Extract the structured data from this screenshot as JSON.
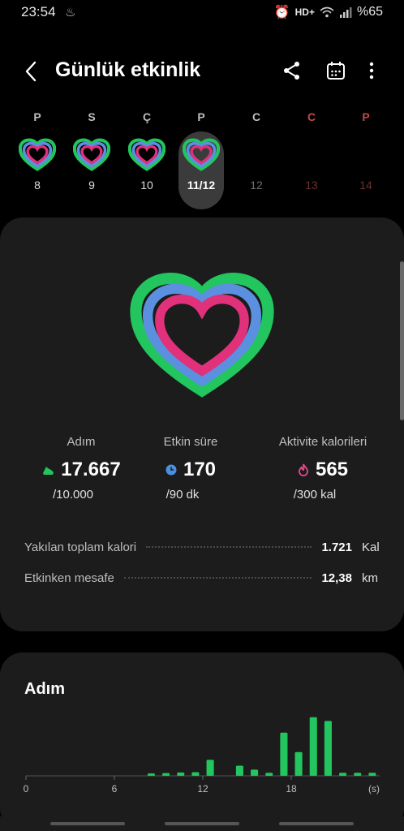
{
  "status": {
    "time": "23:54",
    "network": "HD+",
    "battery": "%65"
  },
  "header": {
    "title": "Günlük etkinlik",
    "share_icon": "share-icon",
    "calendar_icon": "calendar-icon",
    "more_icon": "more-icon"
  },
  "week": [
    {
      "letter": "P",
      "day": "8",
      "has_ring": true
    },
    {
      "letter": "S",
      "day": "9",
      "has_ring": true
    },
    {
      "letter": "Ç",
      "day": "10",
      "has_ring": true
    },
    {
      "letter": "P",
      "day": "11/12",
      "has_ring": true,
      "selected": true
    },
    {
      "letter": "C",
      "day": "12",
      "has_ring": false
    },
    {
      "letter": "C",
      "day": "13",
      "has_ring": false,
      "weekend": true
    },
    {
      "letter": "P",
      "day": "14",
      "has_ring": false,
      "weekend": true
    }
  ],
  "stats": [
    {
      "label": "Adım",
      "value": "17.667",
      "goal": "/10.000",
      "icon": "shoe-icon",
      "color": "#2ecc71"
    },
    {
      "label": "Etkin süre",
      "value": "170",
      "goal": "/90 dk",
      "icon": "clock-icon",
      "color": "#4a90e2"
    },
    {
      "label": "Aktivite kalorileri",
      "value": "565",
      "goal": "/300 kal",
      "icon": "flame-icon",
      "color": "#e84a8a"
    }
  ],
  "summary": [
    {
      "label": "Yakılan toplam kalori",
      "value": "1.721",
      "unit": "Kal"
    },
    {
      "label": "Etkinken mesafe",
      "value": "12,38",
      "unit": "km"
    }
  ],
  "colors": {
    "green": "#22c55e",
    "blue": "#5b8fe0",
    "pink": "#e0317a",
    "card": "#1c1c1c"
  },
  "chart_data": {
    "type": "bar",
    "title": "Adım",
    "x_unit": "(s)",
    "x_tick_labels": [
      "0",
      "6",
      "12",
      "18"
    ],
    "x": [
      0,
      1,
      2,
      3,
      4,
      5,
      6,
      7,
      8,
      9,
      10,
      11,
      12,
      13,
      14,
      15,
      16,
      17,
      18,
      19,
      20,
      21,
      22,
      23
    ],
    "values": [
      0,
      0,
      0,
      0,
      0,
      0,
      0,
      0,
      80,
      90,
      110,
      120,
      520,
      0,
      330,
      200,
      100,
      1400,
      770,
      1900,
      1780,
      100,
      100,
      100
    ],
    "ylim": [
      0,
      2000
    ],
    "color": "#22c55e"
  }
}
